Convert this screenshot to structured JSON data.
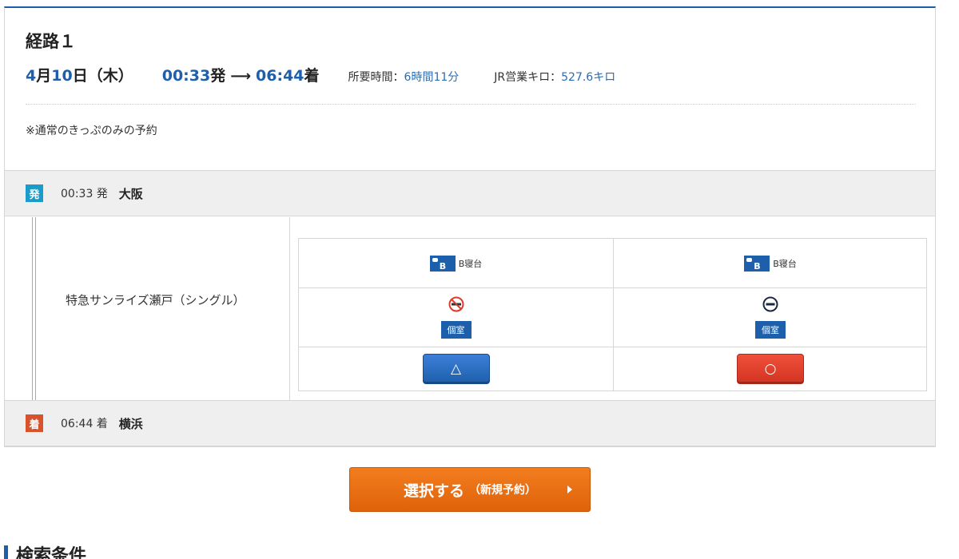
{
  "route": {
    "title": "経路１",
    "date_month": "4",
    "date_month_unit": "月",
    "date_day": "10",
    "date_day_unit": "日（木）",
    "dep_time": "00:33",
    "dep_suffix": "発",
    "arr_time": "06:44",
    "arr_suffix": "着",
    "duration_label": "所要時間：",
    "duration_value": "6時間11分",
    "km_label": "JR営業キロ：",
    "km_value": "527.6キロ",
    "note": "※通常のきっぷのみの予約"
  },
  "departure": {
    "badge": "発",
    "time": "00:33 発",
    "station": "大阪"
  },
  "arrival": {
    "badge": "着",
    "time": "06:44 着",
    "station": "横浜"
  },
  "train": {
    "name": "特急サンライズ瀬戸（シングル）",
    "seats": [
      {
        "type_label": "B寝台",
        "bed_letter": "B",
        "smoking_icon": "no-smoking-icon",
        "room_label": "個室",
        "availability": "△",
        "availability_color": "#1d5fab"
      },
      {
        "type_label": "B寝台",
        "bed_letter": "B",
        "smoking_icon": "no-entry-icon",
        "room_label": "個室",
        "availability": "○",
        "availability_color": "#e03a26"
      }
    ]
  },
  "select_button": {
    "main": "選択する",
    "sub": "（新規予約）"
  },
  "section": {
    "title": "検索条件"
  },
  "colors": {
    "accent": "#1d5fab",
    "select": "#f07417",
    "departure_badge": "#1a9bc9",
    "arrival_badge": "#d6532b"
  }
}
